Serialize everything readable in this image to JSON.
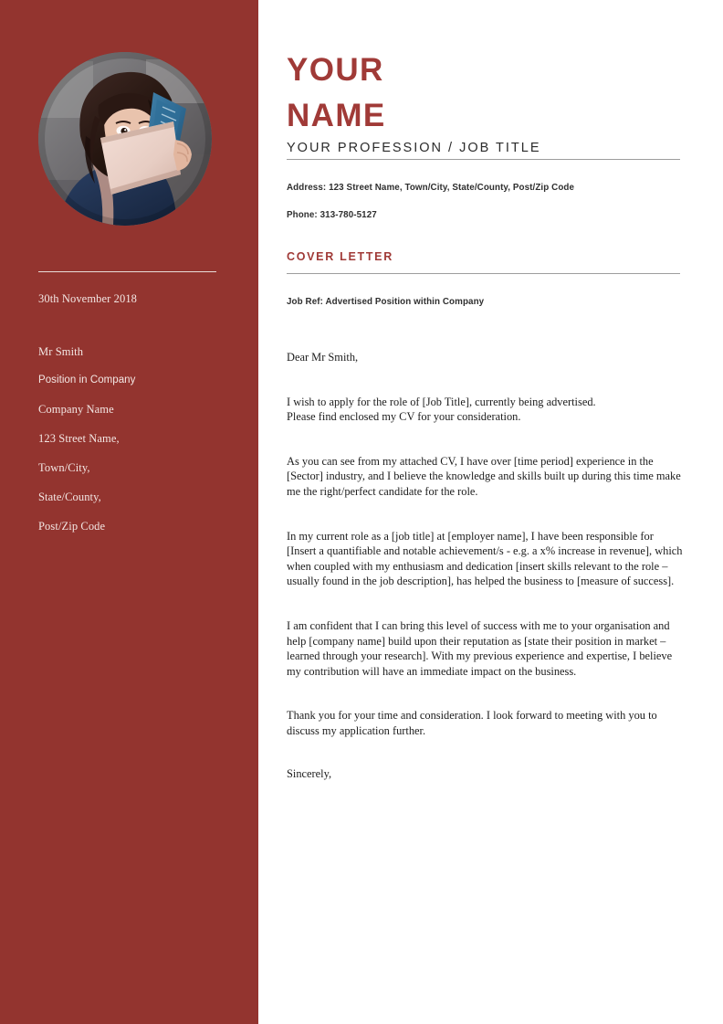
{
  "theme": {
    "sidebar_bg": "#93342F",
    "accent_red": "#A03A37",
    "page_bg": "#ffffff",
    "rule_gray": "#9d9d9d",
    "sidebar_text": "#f3e7e4",
    "body_text": "#1c1c1c"
  },
  "sidebar": {
    "photo": {
      "icon": "portrait-photo",
      "description": "circular portrait photograph of a person holding a book in front of their face"
    },
    "date": "30th November 2018",
    "recipient": [
      {
        "text": "Mr Smith",
        "style": "serif"
      },
      {
        "text": "Position in Company",
        "style": "sans"
      },
      {
        "text": "Company Name",
        "style": "serif"
      },
      {
        "text": "123 Street Name,",
        "style": "serif"
      },
      {
        "text": "Town/City,",
        "style": "serif"
      },
      {
        "text": "State/County,",
        "style": "serif"
      },
      {
        "text": "Post/Zip Code",
        "style": "serif"
      }
    ]
  },
  "header": {
    "name_line_1": "YOUR",
    "name_line_2": "NAME",
    "profession": "YOUR PROFESSION / JOB TITLE"
  },
  "contact": {
    "address": "Address: 123 Street Name, Town/City, State/County, Post/Zip Code",
    "phone": "Phone: 313-780-5127"
  },
  "letter": {
    "section_heading": "COVER LETTER",
    "job_ref": "Job Ref: Advertised Position within Company",
    "salutation": "Dear Mr Smith,",
    "paragraphs": [
      "I wish to apply for the role of [Job Title], currently being advertised.\nPlease find enclosed my CV for your consideration.",
      "As you can see from my attached CV, I have over [time period] experience in the [Sector] industry, and I believe the knowledge and skills built up during this time make me the right/perfect candidate for the role.",
      "In my current role as a [job title] at [employer name], I have been responsible for [Insert a quantifiable and notable achievement/s - e.g. a x% increase in revenue], which when coupled with my enthusiasm and dedication [insert skills relevant to the role – usually found in the job description], has helped the business to [measure of success].",
      "I am confident that I can bring this level of success with me to your organisation and help [company name] build upon their reputation as [state their position in market – learned through your research]. With my previous experience and expertise, I believe my contribution will have an immediate impact on the business.",
      "Thank you for your time and consideration. I look forward to meeting with you to discuss my application further."
    ],
    "sign_off": "Sincerely,"
  }
}
